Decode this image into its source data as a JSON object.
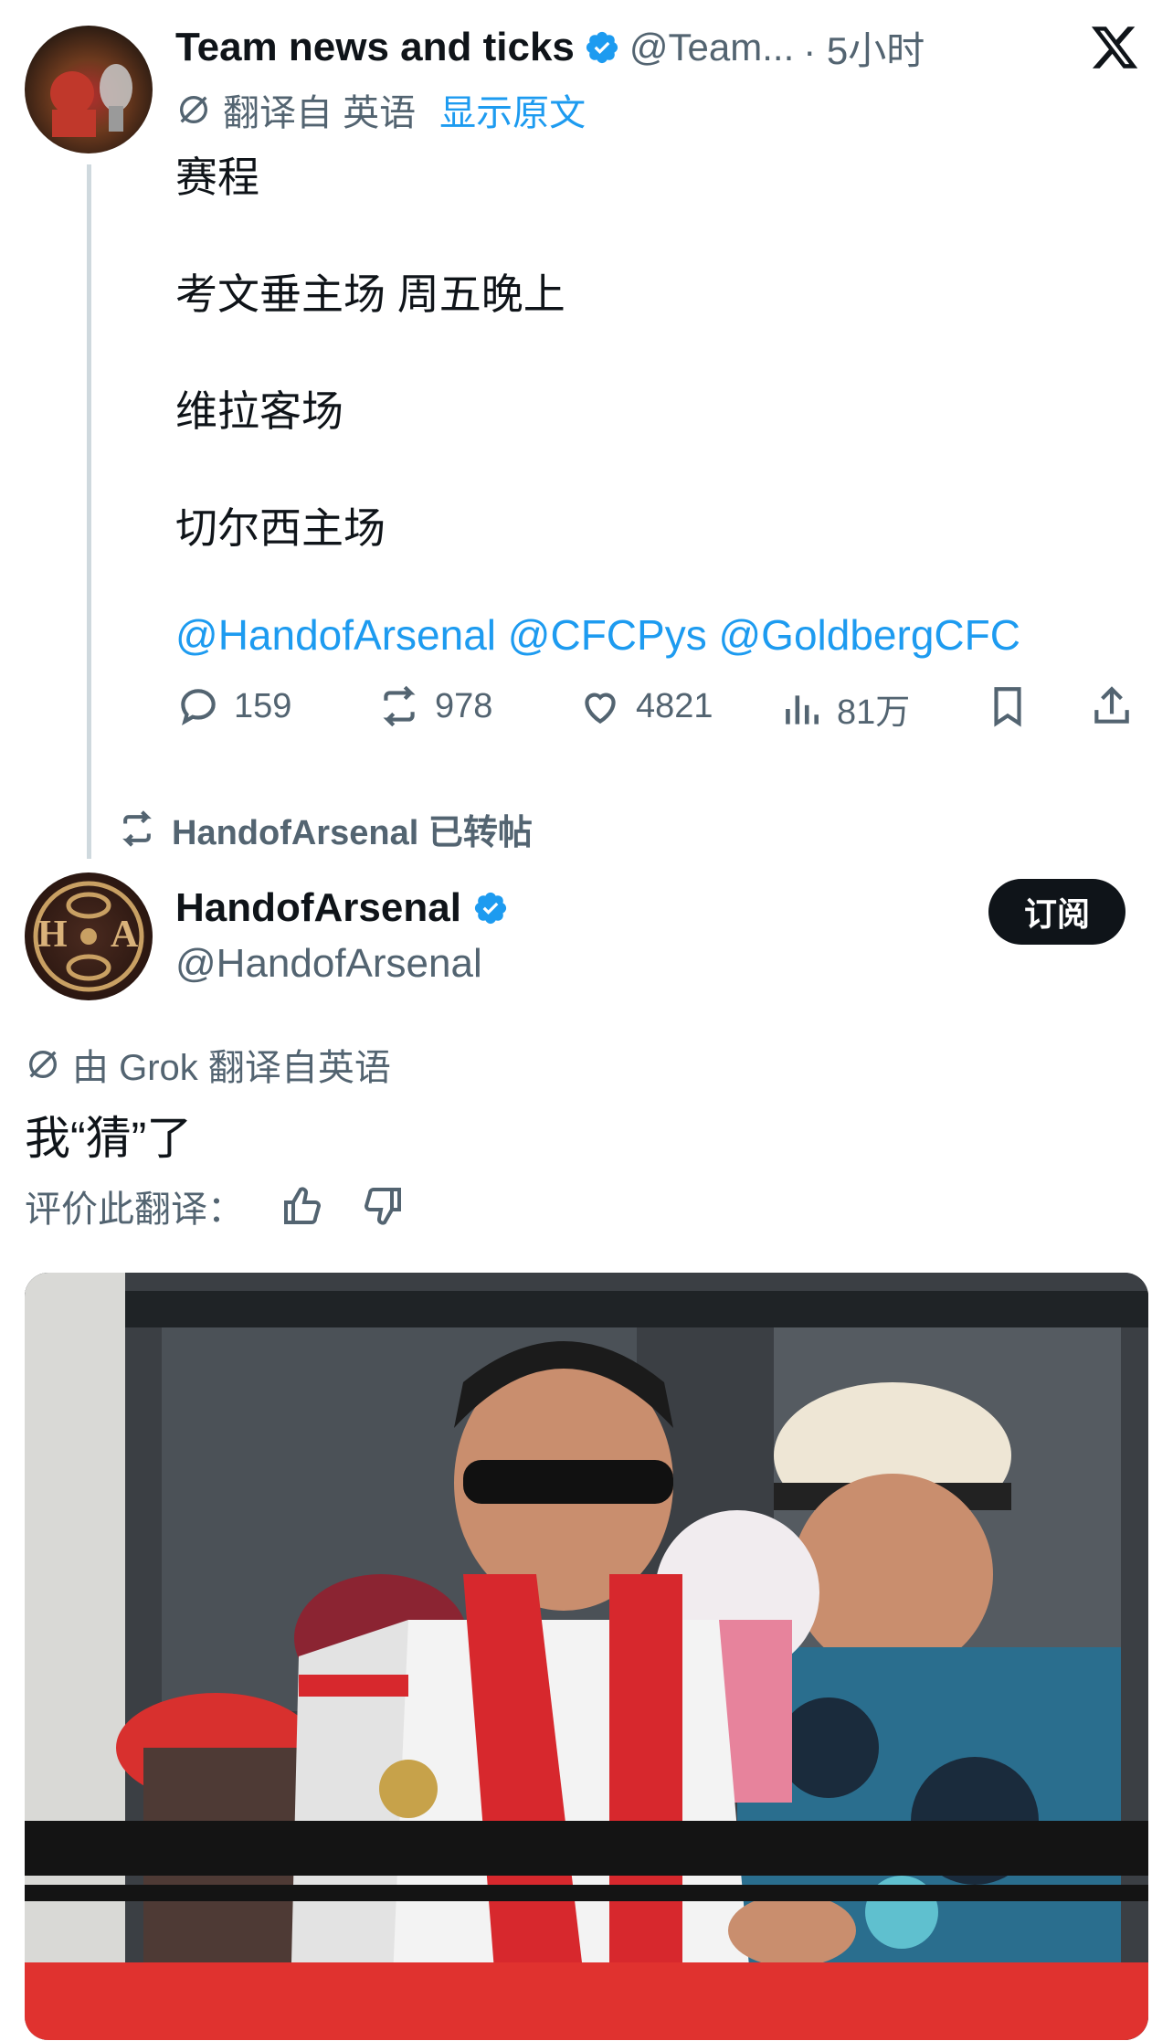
{
  "top_tweet": {
    "display_name": "Team news and ticks",
    "handle": "@Team...",
    "time": "· 5小时",
    "translate_note": "翻译自 英语",
    "show_original": "显示原文",
    "lines": [
      "赛程",
      "考文垂主场 周五晚上",
      "维拉客场",
      "切尔西主场"
    ],
    "mentions": "@HandofArsenal @CFCPys @GoldbergCFC",
    "stats": {
      "replies": "159",
      "reposts": "978",
      "likes": "4821",
      "views": "81万"
    }
  },
  "repost_label": "HandofArsenal 已转帖",
  "quoted": {
    "display_name": "HandofArsenal",
    "handle": "@HandofArsenal",
    "subscribe_label": "订阅",
    "avatar_text_left": "H",
    "avatar_text_right": "A",
    "grok_note": "由 Grok 翻译自英语",
    "text": "我“猜”了",
    "rate_label": "评价此翻译："
  },
  "icons": {
    "close": "x-logo-icon",
    "verified": "verified-badge-icon",
    "translate": "translate-icon",
    "reply": "reply-icon",
    "repost": "repost-icon",
    "like": "heart-icon",
    "views": "views-icon",
    "bookmark": "bookmark-icon",
    "share": "share-icon",
    "thumbs_up": "thumbs-up-icon",
    "thumbs_down": "thumbs-down-icon"
  },
  "colors": {
    "accent": "#1d9bf0",
    "text": "#0f1419",
    "muted": "#536471"
  }
}
